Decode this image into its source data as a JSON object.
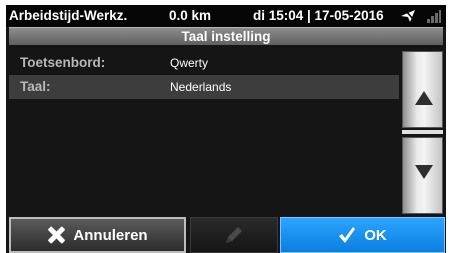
{
  "statusbar": {
    "app_name": "Arbeidstijd-Werkz.",
    "distance": "0.0 km",
    "datetime": "di 15:04 | 17-05-2016",
    "icons": [
      "navigation-arrow-icon",
      "signal-bars-icon"
    ]
  },
  "title": "Taal instelling",
  "settings": [
    {
      "label": "Toetsenbord:",
      "value": "Qwerty",
      "selected": false
    },
    {
      "label": "Taal:",
      "value": "Nederlands",
      "selected": true
    }
  ],
  "scroll": {
    "up_icon": "triangle-up-icon",
    "down_icon": "triangle-down-icon"
  },
  "buttons": {
    "cancel_label": "Annuleren",
    "cancel_icon": "x-icon",
    "edit_icon": "pencil-icon",
    "ok_label": "OK",
    "ok_icon": "checkmark-icon"
  },
  "colors": {
    "ok_button": "#1a94f5",
    "background": "#151515"
  }
}
